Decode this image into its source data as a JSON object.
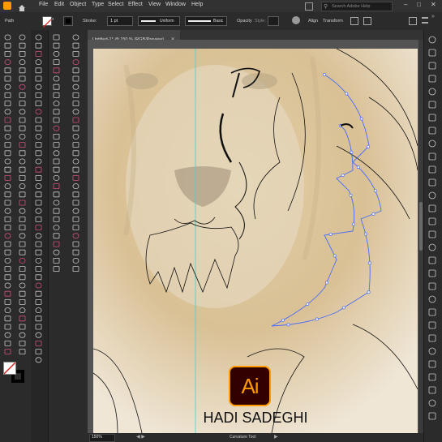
{
  "menubar": {
    "items": [
      "File",
      "Edit",
      "Object",
      "Type",
      "Select",
      "Effect",
      "View",
      "Window",
      "Help"
    ],
    "search_placeholder": "Search Adobe Help"
  },
  "controlbar": {
    "selection_label": "Path",
    "stroke_label": "Stroke:",
    "stroke_value": "1 pt",
    "profile_label": "Uniform",
    "brush_label": "Basic",
    "opacity_label": "Opacity",
    "style_label": "Style:",
    "align_label": "Align",
    "transform_label": "Transform"
  },
  "document": {
    "tab_title": "Untitled-1* @ 150 % (RGB/Preview)"
  },
  "statusbar": {
    "zoom": "150%",
    "tool_name": "Curvature Tool"
  },
  "overlay": {
    "logo_text": "Ai",
    "author": "HADI SADEGHI"
  },
  "colors": {
    "app_bg": "#1e1e1e",
    "panel": "#2b2b2b",
    "artboard": "#f4ede2",
    "path_selected": "#4a6cf7",
    "guide": "#3fd6c6",
    "logo_bg": "#330000",
    "logo_fg": "#ff9a00"
  }
}
